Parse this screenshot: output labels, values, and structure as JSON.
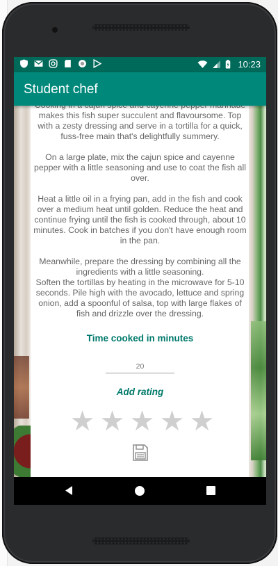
{
  "status_bar": {
    "time": "10:23",
    "icons": [
      "shield-icon",
      "gmail-icon",
      "instagram-icon",
      "sd-card-icon",
      "circle-icon",
      "play-store-icon",
      "wifi-icon",
      "cell-signal-icon",
      "battery-icon"
    ]
  },
  "app_bar": {
    "title": "Student chef"
  },
  "recipe": {
    "text": "Cooking in a cajun spice and cayenne pepper marinade makes this fish super succulent and flavoursome. Top with a zesty dressing and serve in a tortilla for a quick, fuss-free main that's delightfully summery.\n\nOn a large plate, mix the cajun spice and cayenne pepper with a little seasoning and use to coat the fish all over.\n\nHeat a little oil in a frying pan, add in the fish and cook over a medium heat until golden. Reduce the heat and continue frying until the fish is cooked through, about 10 minutes. Cook in batches if you don't have enough room in the pan.\n\nMeanwhile, prepare the dressing by combining all the ingredients with a little seasoning.\nSoften the tortillas by heating in the microwave for 5-10 seconds. Pile high with the avocado, lettuce and spring onion, add a spoonful of salsa, top with large flakes of fish and drizzle over the dressing."
  },
  "time_cooked": {
    "heading": "Time cooked in minutes",
    "placeholder": "20"
  },
  "rating": {
    "heading": "Add rating",
    "value": 0,
    "max": 5,
    "star_color": "#cfcfcf"
  },
  "colors": {
    "status_bar": "#006a5a",
    "app_bar": "#00897b",
    "accent_text": "#00796b"
  }
}
